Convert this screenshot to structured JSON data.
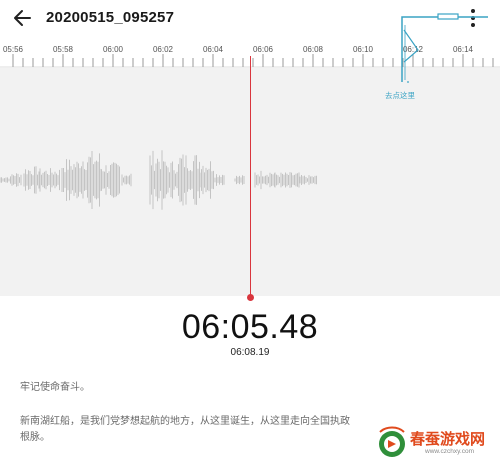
{
  "header": {
    "title": "20200515_095257"
  },
  "timeline": {
    "labels": [
      "05:56",
      "05:58",
      "06:00",
      "06:02",
      "06:04",
      "06:06",
      "06:08",
      "06:10",
      "06:12",
      "06:14"
    ]
  },
  "player": {
    "current_time": "06:05.48",
    "total_time": "06:08.19"
  },
  "annotation": {
    "text": "去点这里"
  },
  "transcript": {
    "line1": "牢记使命奋斗。",
    "line2a": "新南湖红船，是我们党梦想起航的地方，从这里诞生，从这里走向全国执政",
    "line2b": "根脉。"
  },
  "watermark": {
    "title": "春蚕游戏网",
    "url": "www.czchxy.com"
  },
  "colors": {
    "playhead": "#d9363e",
    "annotation": "#3aa3c4",
    "waveform": "#c4c4c4",
    "watermark": "#e04a1d"
  }
}
